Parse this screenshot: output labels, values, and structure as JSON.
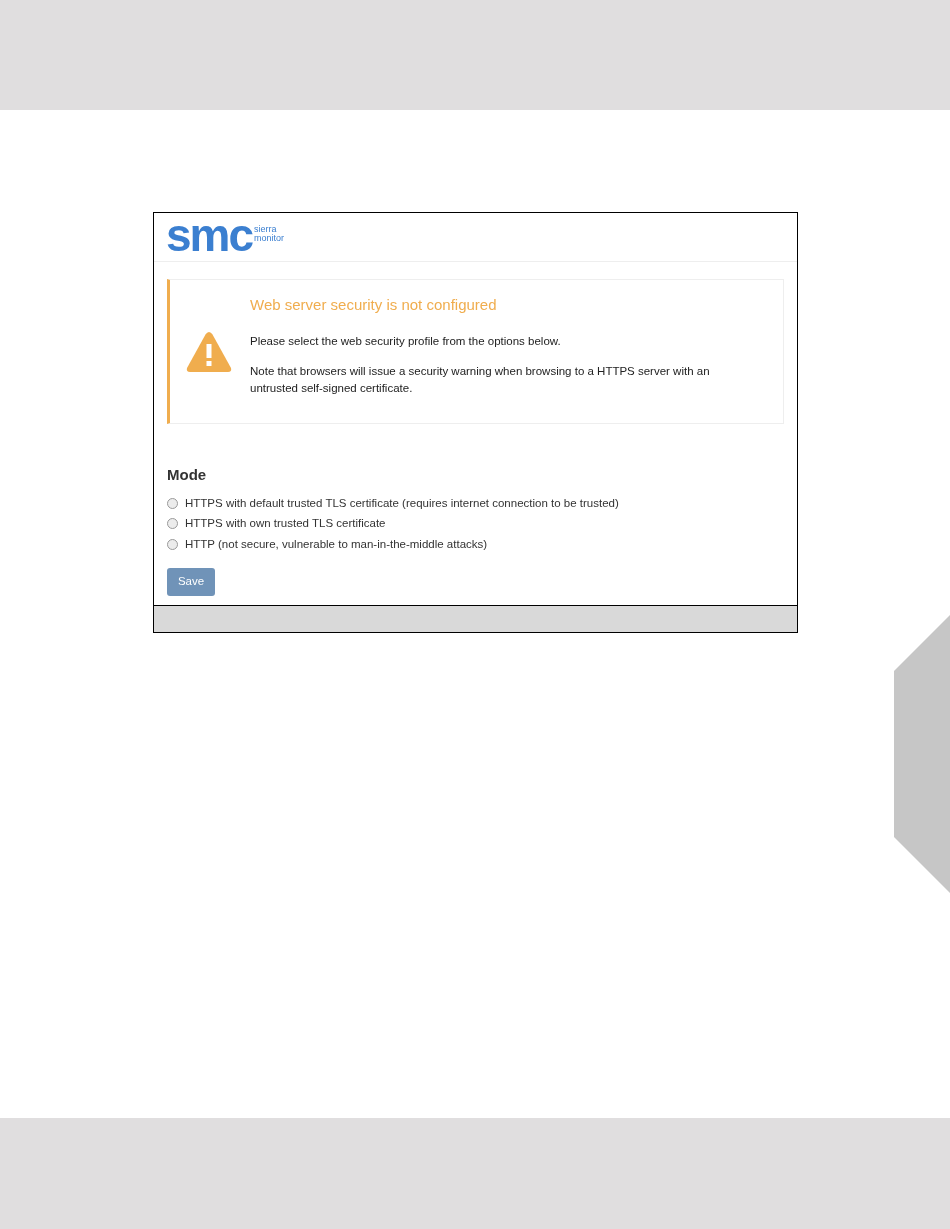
{
  "logo": {
    "mark": "smc",
    "lines": [
      "sierra",
      "monitor"
    ]
  },
  "alert": {
    "title": "Web server security is not configured",
    "paragraphs": [
      "Please select the web security profile from the options below.",
      "Note that browsers will issue a security warning when browsing to a HTTPS server with an untrusted self-signed certificate."
    ]
  },
  "mode": {
    "heading": "Mode",
    "options": [
      {
        "label": "HTTPS with default trusted TLS certificate (requires internet connection to be trusted)",
        "selected": false
      },
      {
        "label": "HTTPS with own trusted TLS certificate",
        "selected": false
      },
      {
        "label": "HTTP (not secure, vulnerable to man-in-the-middle attacks)",
        "selected": false
      }
    ]
  },
  "buttons": [
    "Save"
  ]
}
